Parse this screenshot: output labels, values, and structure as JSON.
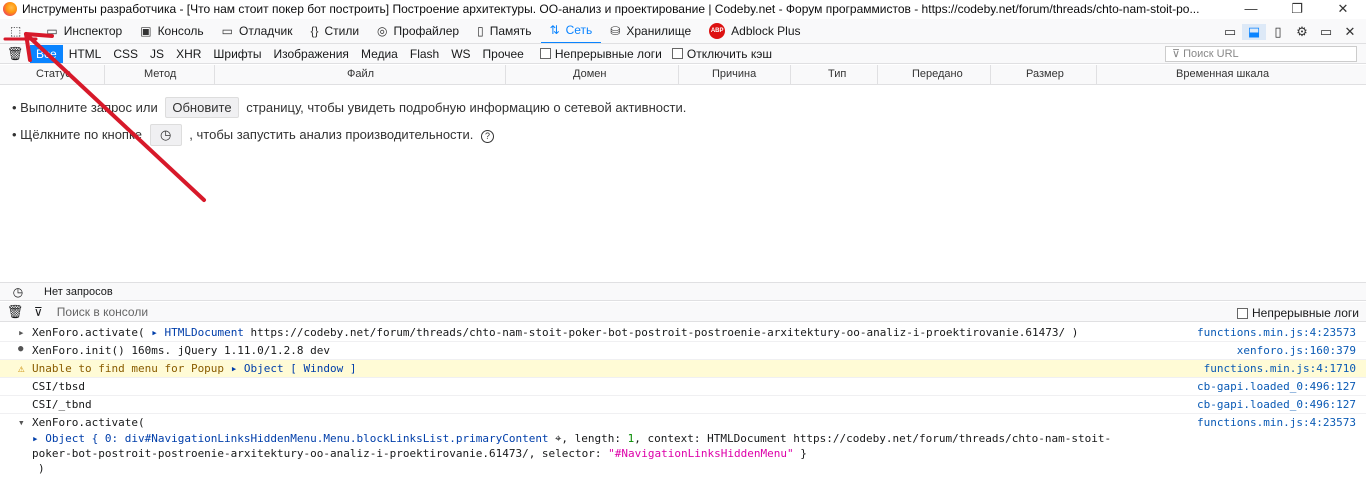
{
  "window": {
    "title": "Инструменты разработчика - [Что нам стоит покер бот построить] Построение архитектуры. ОО-анализ и проектирование | Codeby.net - Форум программистов - https://codeby.net/forum/threads/chto-nam-stoit-po...",
    "min": "—",
    "restore": "❐",
    "close": "✕"
  },
  "toolbar": {
    "tools": [
      {
        "label": "Инспектор",
        "icon": "inspector-icon",
        "glyph": "▭"
      },
      {
        "label": "Консоль",
        "icon": "console-icon",
        "glyph": "▣"
      },
      {
        "label": "Отладчик",
        "icon": "debugger-icon",
        "glyph": "▭"
      },
      {
        "label": "Стили",
        "icon": "style-editor-icon",
        "glyph": "{}"
      },
      {
        "label": "Профайлер",
        "icon": "performance-icon",
        "glyph": "◎"
      },
      {
        "label": "Память",
        "icon": "memory-icon",
        "glyph": "▯"
      },
      {
        "label": "Сеть",
        "icon": "network-icon",
        "glyph": "⇅"
      },
      {
        "label": "Хранилище",
        "icon": "storage-icon",
        "glyph": "⛁"
      },
      {
        "label": "Adblock Plus",
        "icon": "adblock-icon",
        "glyph": "ABP"
      }
    ]
  },
  "filters": {
    "types": [
      "Все",
      "HTML",
      "CSS",
      "JS",
      "XHR",
      "Шрифты",
      "Изображения",
      "Медиа",
      "Flash",
      "WS",
      "Прочее"
    ],
    "persist_logs": "Непрерывные логи",
    "disable_cache": "Отключить кэш",
    "url_placeholder": "Поиск URL"
  },
  "columns": [
    "Статус",
    "Метод",
    "Файл",
    "Домен",
    "Причина",
    "Тип",
    "Передано",
    "Размер",
    "Временная шкала"
  ],
  "empty": {
    "line1_a": "• Выполните запрос или",
    "reload": "Обновите",
    "line1_b": "страницу, чтобы увидеть подробную информацию о сетевой активности.",
    "line2_a": "• Щёлкните по кнопке",
    "line2_b": ", чтобы запустить анализ производительности."
  },
  "status": {
    "text": "Нет запросов"
  },
  "console": {
    "filter_placeholder": "Поиск в консоли",
    "persist_logs": "Непрерывные логи",
    "lines": [
      {
        "expander": "▸",
        "msg": "XenForo.activate( ",
        "obj": "▸ HTMLDocument",
        "rest": " https://codeby.net/forum/threads/chto-nam-stoit-poker-bot-postroit-postroenie-arxitektury-oo-analiz-i-proektirovanie.61473/ )",
        "src": "functions.min.js:4:23573"
      },
      {
        "expander": "●",
        "msg": "XenForo.init() 160ms. jQuery 1.11.0/1.2.8 dev",
        "src": "xenforo.js:160:379"
      },
      {
        "expander": "⚠",
        "msg": "Unable to find menu for Popup ",
        "obj": "▸ Object [ Window ]",
        "src": "functions.min.js:4:1710"
      },
      {
        "msg": "CSI/tbsd",
        "src": "cb-gapi.loaded_0:496:127"
      },
      {
        "msg": "CSI/_tbnd",
        "src": "cb-gapi.loaded_0:496:127"
      },
      {
        "expander": "▾",
        "msg": "XenForo.activate(",
        "src": "functions.min.js:4:23573"
      }
    ],
    "object_line1_a": "▸ Object { 0: div#NavigationLinksHiddenMenu.Menu.blockLinksList.primaryContent",
    "object_line1_b": ", length: ",
    "object_line1_num": "1",
    "object_line1_c": ", context: HTMLDocument https://codeby.net/forum/threads/chto-nam-stoit-",
    "object_line2_a": "poker-bot-postroit-postroenie-arxitektury-oo-analiz-i-proektirovanie.61473/, selector: ",
    "object_line2_str": "\"#NavigationLinksHiddenMenu\"",
    "object_line2_b": " }",
    "close_paren": ")"
  },
  "colors": {
    "accent": "#0a84ff",
    "annotation": "#d7192a",
    "warning_bg": "#fffbd6"
  }
}
